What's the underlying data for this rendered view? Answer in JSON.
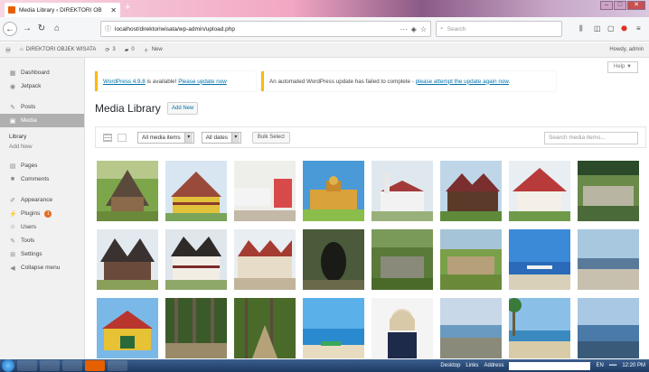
{
  "browser": {
    "tab_title": "Media Library ‹ DIREKTORI OB",
    "url": "localhost/direktoriwisata/wp-admin/upload.php",
    "search_placeholder": "Search",
    "tab_close": "✕",
    "new_tab": "+",
    "url_more": "···"
  },
  "adminbar": {
    "site_name": "DIREKTORI OBJEK WISATA",
    "updates_count": "3",
    "comments_count": "0",
    "new_label": "New",
    "howdy": "Howdy, admin"
  },
  "sidebar": {
    "items": [
      {
        "label": "Dashboard",
        "icon": "dashboard-icon",
        "glyph": "▦"
      },
      {
        "label": "Jetpack",
        "icon": "jetpack-icon",
        "glyph": "◉"
      },
      {
        "label": "Posts",
        "icon": "pin-icon",
        "glyph": "✎"
      },
      {
        "label": "Media",
        "icon": "media-icon",
        "glyph": "▣"
      },
      {
        "label": "Pages",
        "icon": "pages-icon",
        "glyph": "▤"
      },
      {
        "label": "Comments",
        "icon": "comment-icon",
        "glyph": "■"
      },
      {
        "label": "Appearance",
        "icon": "brush-icon",
        "glyph": "✐"
      },
      {
        "label": "Plugins",
        "icon": "plugin-icon",
        "glyph": "⚡"
      },
      {
        "label": "Users",
        "icon": "users-icon",
        "glyph": "☺"
      },
      {
        "label": "Tools",
        "icon": "wrench-icon",
        "glyph": "✎"
      },
      {
        "label": "Settings",
        "icon": "settings-icon",
        "glyph": "⊞"
      },
      {
        "label": "Collapse menu",
        "icon": "collapse-icon",
        "glyph": "◀"
      }
    ],
    "submenu_library": "Library",
    "submenu_addnew": "Add New",
    "plugins_badge": "1"
  },
  "notices": {
    "update_available_link": "WordPress 4.9.8",
    "update_available_text": " is available! ",
    "update_now_link": "Please update now",
    "failed_text": "An automated WordPress update has failed to complete - ",
    "failed_link": "please attempt the update again now",
    "failed_end": "."
  },
  "help_label": "Help ▼",
  "page_title": "Media Library",
  "add_new_label": "Add New",
  "filters": {
    "media_type": "All media items",
    "dates": "All dates",
    "bulk_select": "Bulk Select",
    "search_placeholder": "Search media items..."
  },
  "taskbar": {
    "desktop": "Desktop",
    "links": "Links",
    "address": "Address",
    "lang": "EN",
    "clock": "12:20 PM"
  },
  "colors": {
    "accent": "#0073aa",
    "notice_border": "#ffb900",
    "active_menu": "#b0b0b0"
  }
}
